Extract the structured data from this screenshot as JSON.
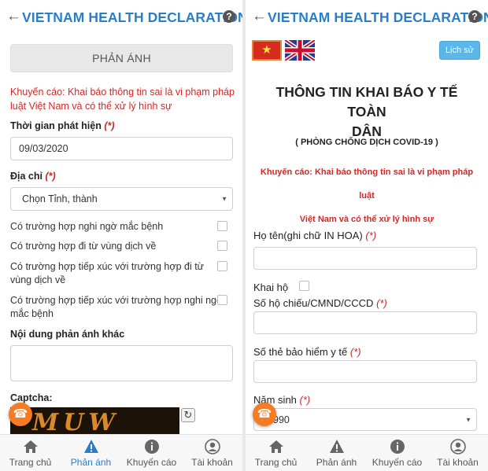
{
  "app": {
    "title": "VIETNAM HEALTH DECLARATION",
    "help_glyph": "?"
  },
  "left": {
    "tab_label": "PHẢN ÁNH",
    "warning_line1": "Khuyến cáo: Khai báo thông tin sai là vi phạm pháp",
    "warning_line2": "luật Việt Nam và có thể xử lý hình sự",
    "time_label": "Thời gian phát hiện",
    "time_value": "09/03/2020",
    "address_label": "Địa chỉ",
    "address_placeholder": "Chọn Tỉnh, thành",
    "checks": [
      {
        "line1": "Có trường hợp nghi ngờ mắc bệnh",
        "line2": ""
      },
      {
        "line1": "Có trường hợp đi từ vùng dịch về",
        "line2": ""
      },
      {
        "line1": "Có trường hợp tiếp xúc với trường hợp đi từ",
        "line2": "vùng dịch về"
      },
      {
        "line1": "Có trường hợp tiếp xúc với trường hợp nghi ngờ",
        "line2": "mắc bệnh"
      }
    ],
    "other_label": "Nội dung phản ánh khác",
    "captcha_label": "Captcha:",
    "captcha_text": "MUW"
  },
  "right": {
    "history_label": "Lịch sử",
    "title_line1": "THÔNG TIN KHAI BÁO Y TẾ TOÀN",
    "title_line2": "DÂN",
    "subtitle": "( PHÒNG CHỐNG DỊCH COVID-19 )",
    "warning_line1": "Khuyến cáo: Khai báo thông tin sai là vi phạm pháp luật",
    "warning_line2": "Việt Nam và có thể xử lý hình sự",
    "name_label": "Họ tên(ghi chữ IN HOA)",
    "khai_ho_label": "Khai hộ",
    "passport_label": "Số hộ chiếu/CMND/CCCD",
    "insurance_label": "Số thẻ bảo hiểm y tế",
    "birth_label": "Năm sinh",
    "birth_value": "990"
  },
  "required_mark": "(*)",
  "nav": [
    {
      "label": "Trang chủ"
    },
    {
      "label": "Phản ánh"
    },
    {
      "label": "Khuyến cáo"
    },
    {
      "label": "Tài khoản"
    }
  ],
  "colors": {
    "brand": "#2a7ec9",
    "warning": "#d52727",
    "fab": "#f57c22",
    "history": "#5bb7e8"
  }
}
